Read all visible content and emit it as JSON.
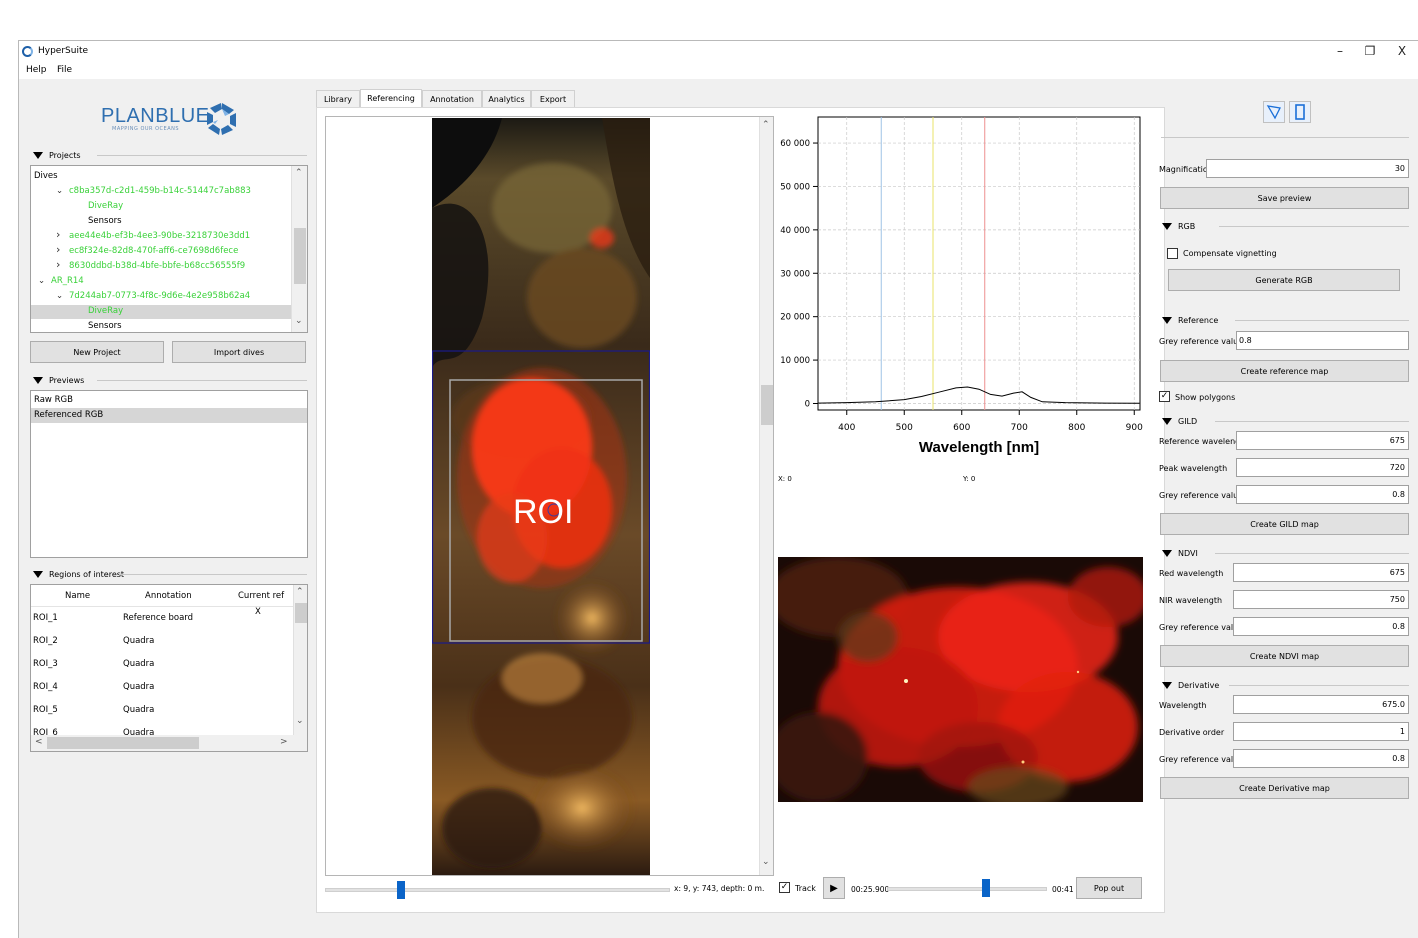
{
  "app": {
    "title": "HyperSuite",
    "minimize": "–",
    "restore": "❐",
    "close": "X"
  },
  "menu": [
    "Help",
    "File"
  ],
  "logo": {
    "name": "PLANBLUE",
    "tagline": "MAPPING OUR OCEANS"
  },
  "projects": {
    "header": "Projects",
    "tree": [
      {
        "text": "Dives",
        "indent": 0,
        "arrow": "",
        "green": false
      },
      {
        "text": "c8ba357d-c2d1-459b-b14c-51447c7ab883",
        "indent": 1,
        "arrow": "v",
        "green": true
      },
      {
        "text": "DiveRay",
        "indent": 2,
        "arrow": "",
        "green": true
      },
      {
        "text": "Sensors",
        "indent": 2,
        "arrow": "",
        "green": false
      },
      {
        "text": "aee44e4b-ef3b-4ee3-90be-3218730e3dd1",
        "indent": 1,
        "arrow": ">",
        "green": true
      },
      {
        "text": "ec8f324e-82d8-470f-aff6-ce7698d6fece",
        "indent": 1,
        "arrow": ">",
        "green": true
      },
      {
        "text": "8630ddbd-b38d-4bfe-bbfe-b68cc56555f9",
        "indent": 1,
        "arrow": ">",
        "green": true
      },
      {
        "text": "AR_R14",
        "indent": 0,
        "arrow": "v",
        "green": true
      },
      {
        "text": "7d244ab7-0773-4f8c-9d6e-4e2e958b62a4",
        "indent": 1,
        "arrow": "v",
        "green": true
      },
      {
        "text": "DiveRay",
        "indent": 2,
        "arrow": "",
        "green": true,
        "selected": true
      },
      {
        "text": "Sensors",
        "indent": 2,
        "arrow": "",
        "green": false
      }
    ],
    "new_project": "New Project",
    "import_dives": "Import dives"
  },
  "previews": {
    "header": "Previews",
    "items": [
      "Raw RGB",
      "Referenced RGB"
    ],
    "selected": 1
  },
  "roi": {
    "header": "Regions of interest",
    "columns": [
      "Name",
      "Annotation",
      "Current ref"
    ],
    "rows": [
      {
        "name": "ROI_1",
        "annotation": "Reference board",
        "current": "X"
      },
      {
        "name": "ROI_2",
        "annotation": "Quadra",
        "current": ""
      },
      {
        "name": "ROI_3",
        "annotation": "Quadra",
        "current": ""
      },
      {
        "name": "ROI_4",
        "annotation": "Quadra",
        "current": ""
      },
      {
        "name": "ROI_5",
        "annotation": "Quadra",
        "current": ""
      },
      {
        "name": "ROI_6",
        "annotation": "Quadra",
        "current": ""
      }
    ]
  },
  "tabs": [
    "Library",
    "Referencing",
    "Annotation",
    "Analytics",
    "Export"
  ],
  "active_tab": 1,
  "image_view": {
    "roi_label": "ROI",
    "status": "x:   9, y:  743, depth:    0 m.",
    "slider_position": 0.22
  },
  "playback": {
    "track_label": "Track",
    "track_checked": true,
    "current_time": "00:25.900",
    "end_time": "00:41",
    "position": 0.62,
    "pop_out": "Pop out"
  },
  "coords": {
    "x": "X: 0",
    "y": "Y: 0"
  },
  "chart_data": {
    "type": "line",
    "xlabel": "Wavelength [nm]",
    "ylabel": "",
    "xlim": [
      350,
      910
    ],
    "ylim": [
      -1500,
      66000
    ],
    "xticks": [
      400,
      500,
      600,
      700,
      800,
      900
    ],
    "yticks": [
      0,
      10000,
      20000,
      30000,
      40000,
      50000,
      60000
    ],
    "ytick_labels": [
      "0",
      "10 000",
      "20 000",
      "30 000",
      "40 000",
      "50 000",
      "60 000"
    ],
    "grid": true,
    "markers": [
      {
        "x": 460,
        "color": "#9fc3e6"
      },
      {
        "x": 550,
        "color": "#e8e36a"
      },
      {
        "x": 640,
        "color": "#ee8f8f"
      }
    ],
    "series": [
      {
        "color": "#000000",
        "x": [
          350,
          400,
          450,
          500,
          530,
          560,
          590,
          610,
          630,
          650,
          670,
          690,
          705,
          720,
          740,
          780,
          850,
          910
        ],
        "y": [
          100,
          200,
          400,
          900,
          1600,
          2600,
          3600,
          3800,
          3300,
          2100,
          1700,
          2400,
          2700,
          1400,
          400,
          200,
          100,
          50
        ]
      }
    ]
  },
  "right_panel": {
    "magnification_label": "Magnification",
    "magnification_value": "30",
    "save_preview": "Save preview",
    "rgb": {
      "header": "RGB",
      "compensate_label": "Compensate vignetting",
      "compensate_checked": false,
      "generate": "Generate RGB"
    },
    "reference": {
      "header": "Reference",
      "grey_label": "Grey reference value",
      "grey_value": "0.8",
      "create": "Create reference map",
      "show_polygons": "Show polygons",
      "show_polygons_checked": true
    },
    "gild": {
      "header": "GILD",
      "ref_wl_label": "Reference wavelength",
      "ref_wl": "675",
      "peak_wl_label": "Peak wavelength",
      "peak_wl": "720",
      "grey_label": "Grey reference value",
      "grey": "0.8",
      "create": "Create GILD map"
    },
    "ndvi": {
      "header": "NDVI",
      "red_label": "Red wavelength",
      "red": "675",
      "nir_label": "NIR wavelength",
      "nir": "750",
      "grey_label": "Grey reference value",
      "grey": "0.8",
      "create": "Create NDVI map"
    },
    "derivative": {
      "header": "Derivative",
      "wl_label": "Wavelength",
      "wl": "675.0",
      "order_label": "Derivative order",
      "order": "1",
      "grey_label": "Grey reference value",
      "grey": "0.8",
      "create": "Create Derivative map"
    }
  },
  "colors": {
    "selection": "#d6d6d6",
    "tree_green": "#39d139",
    "logo_blue": "#2f6fb0",
    "roi_box": "#1a1a8a"
  }
}
